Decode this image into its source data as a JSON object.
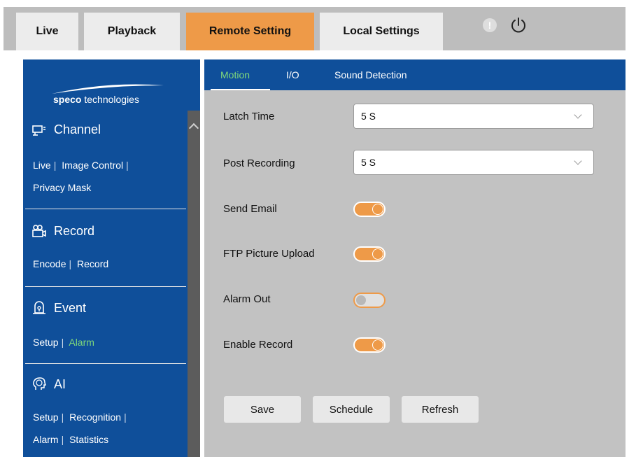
{
  "nav": {
    "tabs": [
      {
        "label": "Live"
      },
      {
        "label": "Playback"
      },
      {
        "label": "Remote Setting"
      },
      {
        "label": "Local Settings"
      }
    ],
    "active_tab": "Remote Setting",
    "accent_color": "#ee9a48"
  },
  "sidebar": {
    "logo": {
      "brand": "speco",
      "suffix": "technologies"
    },
    "sections": [
      {
        "title": "Channel",
        "icon": "channel-icon",
        "links": [
          "Live",
          "Image Control",
          "Privacy Mask"
        ]
      },
      {
        "title": "Record",
        "icon": "record-icon",
        "links": [
          "Encode",
          "Record"
        ]
      },
      {
        "title": "Event",
        "icon": "event-icon",
        "links": [
          "Setup",
          "Alarm"
        ],
        "active_link": "Alarm"
      },
      {
        "title": "AI",
        "icon": "ai-icon",
        "links": [
          "Setup",
          "Recognition",
          "Alarm",
          "Statistics"
        ]
      }
    ],
    "color": "#0f4f9a"
  },
  "subtabs": [
    {
      "label": "Motion"
    },
    {
      "label": "I/O"
    },
    {
      "label": "Sound Detection"
    }
  ],
  "active_subtab": "Motion",
  "form": {
    "latch_time": {
      "label": "Latch Time",
      "value": "5 S"
    },
    "post_recording": {
      "label": "Post Recording",
      "value": "5 S"
    },
    "send_email": {
      "label": "Send Email",
      "on": true
    },
    "ftp_upload": {
      "label": "FTP Picture Upload",
      "on": true
    },
    "alarm_out": {
      "label": "Alarm Out",
      "on": false
    },
    "enable_record": {
      "label": "Enable Record",
      "on": true
    }
  },
  "buttons": {
    "save": "Save",
    "schedule": "Schedule",
    "refresh": "Refresh"
  },
  "icons": {
    "alert": "!"
  }
}
